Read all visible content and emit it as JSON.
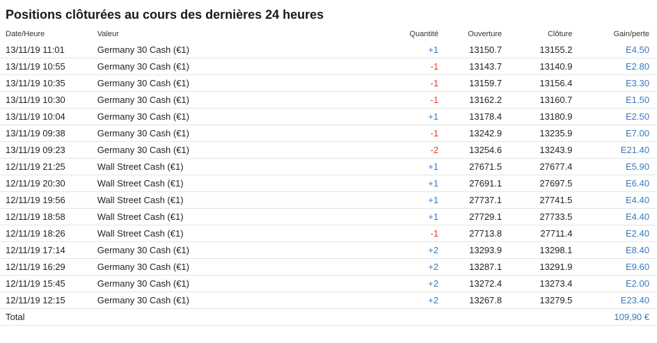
{
  "title": "Positions clôturées au cours des dernières 24 heures",
  "colors": {
    "positive_qty": "#3b78b8",
    "negative_qty": "#e53935",
    "gain": "#3b78b8"
  },
  "columns": {
    "date": "Date/Heure",
    "value": "Valeur",
    "quantity": "Quantité",
    "open": "Ouverture",
    "close": "Clôture",
    "gain": "Gain/perte"
  },
  "rows": [
    {
      "date": "13/11/19 11:01",
      "value": "Germany 30 Cash (€1)",
      "quantity": "+1",
      "open": "13150.7",
      "close": "13155.2",
      "gain": "E4.50"
    },
    {
      "date": "13/11/19 10:55",
      "value": "Germany 30 Cash (€1)",
      "quantity": "-1",
      "open": "13143.7",
      "close": "13140.9",
      "gain": "E2.80"
    },
    {
      "date": "13/11/19 10:35",
      "value": "Germany 30 Cash (€1)",
      "quantity": "-1",
      "open": "13159.7",
      "close": "13156.4",
      "gain": "E3.30"
    },
    {
      "date": "13/11/19 10:30",
      "value": "Germany 30 Cash (€1)",
      "quantity": "-1",
      "open": "13162.2",
      "close": "13160.7",
      "gain": "E1.50"
    },
    {
      "date": "13/11/19 10:04",
      "value": "Germany 30 Cash (€1)",
      "quantity": "+1",
      "open": "13178.4",
      "close": "13180.9",
      "gain": "E2.50"
    },
    {
      "date": "13/11/19 09:38",
      "value": "Germany 30 Cash (€1)",
      "quantity": "-1",
      "open": "13242.9",
      "close": "13235.9",
      "gain": "E7.00"
    },
    {
      "date": "13/11/19 09:23",
      "value": "Germany 30 Cash (€1)",
      "quantity": "-2",
      "open": "13254.6",
      "close": "13243.9",
      "gain": "E21.40"
    },
    {
      "date": "12/11/19 21:25",
      "value": "Wall Street Cash (€1)",
      "quantity": "+1",
      "open": "27671.5",
      "close": "27677.4",
      "gain": "E5.90"
    },
    {
      "date": "12/11/19 20:30",
      "value": "Wall Street Cash (€1)",
      "quantity": "+1",
      "open": "27691.1",
      "close": "27697.5",
      "gain": "E6.40"
    },
    {
      "date": "12/11/19 19:56",
      "value": "Wall Street Cash (€1)",
      "quantity": "+1",
      "open": "27737.1",
      "close": "27741.5",
      "gain": "E4.40"
    },
    {
      "date": "12/11/19 18:58",
      "value": "Wall Street Cash (€1)",
      "quantity": "+1",
      "open": "27729.1",
      "close": "27733.5",
      "gain": "E4.40"
    },
    {
      "date": "12/11/19 18:26",
      "value": "Wall Street Cash (€1)",
      "quantity": "-1",
      "open": "27713.8",
      "close": "27711.4",
      "gain": "E2.40"
    },
    {
      "date": "12/11/19 17:14",
      "value": "Germany 30 Cash (€1)",
      "quantity": "+2",
      "open": "13293.9",
      "close": "13298.1",
      "gain": "E8.40"
    },
    {
      "date": "12/11/19 16:29",
      "value": "Germany 30 Cash (€1)",
      "quantity": "+2",
      "open": "13287.1",
      "close": "13291.9",
      "gain": "E9.60"
    },
    {
      "date": "12/11/19 15:45",
      "value": "Germany 30 Cash (€1)",
      "quantity": "+2",
      "open": "13272.4",
      "close": "13273.4",
      "gain": "E2.00"
    },
    {
      "date": "12/11/19 12:15",
      "value": "Germany 30 Cash (€1)",
      "quantity": "+2",
      "open": "13267.8",
      "close": "13279.5",
      "gain": "E23.40"
    }
  ],
  "total": {
    "label": "Total",
    "value": "109,90 €"
  }
}
